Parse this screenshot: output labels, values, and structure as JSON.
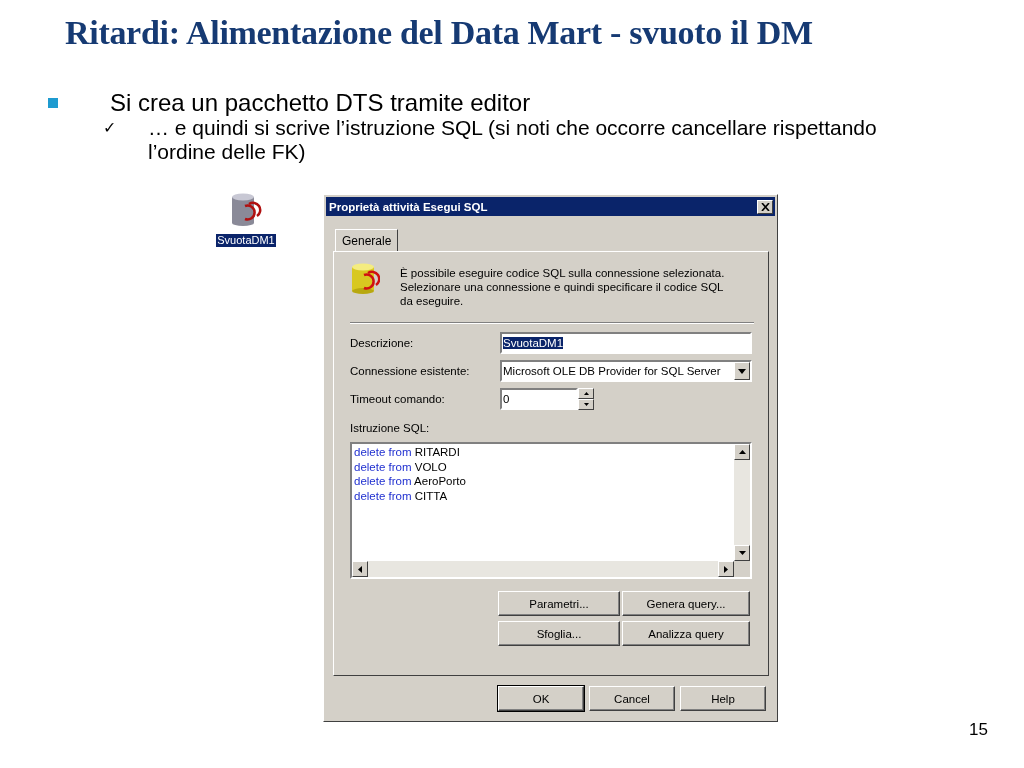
{
  "slide": {
    "title": "Ritardi: Alimentazione del Data Mart - svuoto il DM",
    "bullets": [
      {
        "text": "Si crea un pacchetto DTS tramite editor",
        "children": [
          {
            "marker": "✓",
            "text": "… e quindi si scrive l’istruzione SQL (si noti che occorre cancellare rispettando l’ordine delle FK)"
          }
        ]
      }
    ],
    "page_number": "15"
  },
  "desktop_icon": {
    "label": "SvuotaDM1",
    "selected": true
  },
  "dialog": {
    "title": "Proprietà attività Esegui SQL",
    "tabs": [
      {
        "label": "Generale",
        "selected": true
      }
    ],
    "info_text": "È possibile eseguire codice SQL sulla connessione selezionata. Selezionare una connessione e quindi specificare il codice SQL da eseguire.",
    "fields": [
      {
        "kind": "text",
        "label": "Descrizione:",
        "value": "SvuotaDM1",
        "selected": true
      },
      {
        "kind": "dropdown",
        "label": "Connessione esistente:",
        "value": "Microsoft OLE DB Provider for SQL Server",
        "selected": false
      },
      {
        "kind": "spinner",
        "label": "Timeout comando:",
        "value": "0",
        "selected": false
      }
    ],
    "sql": {
      "label": "Istruzione SQL:",
      "lines": [
        {
          "keyword": "delete from",
          "table": "RITARDI"
        },
        {
          "keyword": "delete from",
          "table": "VOLO"
        },
        {
          "keyword": "delete from",
          "table": "AeroPorto"
        },
        {
          "keyword": "delete from",
          "table": "CITTA"
        }
      ]
    },
    "action_buttons": [
      "Parametri...",
      "Genera query...",
      "Sfoglia...",
      "Analizza query"
    ],
    "buttons": [
      {
        "label": "OK",
        "default": true
      },
      {
        "label": "Cancel",
        "default": false
      },
      {
        "label": "Help",
        "default": false
      }
    ]
  }
}
